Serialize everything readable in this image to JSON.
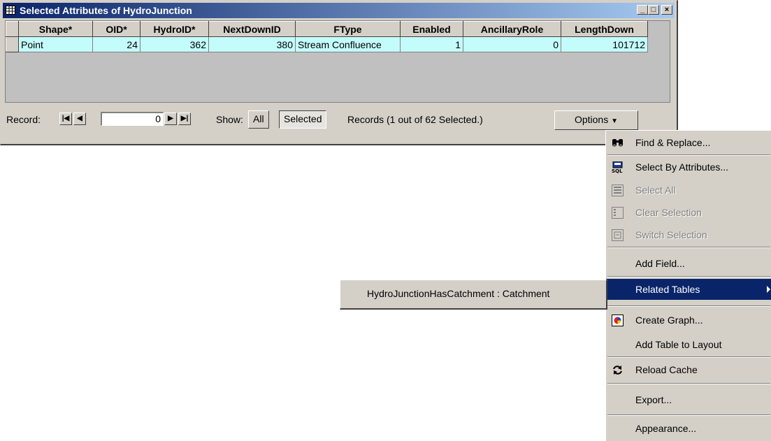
{
  "window": {
    "title": "Selected Attributes of HydroJunction",
    "minimize_glyph": "_",
    "maximize_glyph": "□",
    "close_glyph": "×"
  },
  "table": {
    "columns": [
      "Shape*",
      "OID*",
      "HydroID*",
      "NextDownID",
      "FType",
      "Enabled",
      "AncillaryRole",
      "LengthDown"
    ],
    "rows": [
      [
        "Point",
        "24",
        "362",
        "380",
        "Stream Confluence",
        "1",
        "0",
        "101712"
      ]
    ]
  },
  "statusbar": {
    "record_label": "Record:",
    "record_value": "0",
    "show_label": "Show:",
    "all_button": "All",
    "selected_button": "Selected",
    "records_text": "Records  (1 out of 62 Selected.)",
    "options_button": "Options"
  },
  "menu": {
    "items": [
      {
        "label": "Find & Replace...",
        "icon": "binoculars-icon",
        "enabled": true
      },
      {
        "label": "Select By Attributes...",
        "icon": "sql-icon",
        "enabled": true
      },
      {
        "label": "Select All",
        "icon": "select-all-icon",
        "enabled": false
      },
      {
        "label": "Clear Selection",
        "icon": "clear-selection-icon",
        "enabled": false
      },
      {
        "label": "Switch Selection",
        "icon": "switch-selection-icon",
        "enabled": false
      },
      {
        "label": "Add Field...",
        "icon": "",
        "enabled": true
      },
      {
        "label": "Related Tables",
        "icon": "",
        "enabled": true,
        "highlighted": true
      },
      {
        "label": "Create Graph...",
        "icon": "graph-icon",
        "enabled": true
      },
      {
        "label": "Add Table to Layout",
        "icon": "",
        "enabled": true
      },
      {
        "label": "Reload Cache",
        "icon": "reload-icon",
        "enabled": true
      },
      {
        "label": "Export...",
        "icon": "",
        "enabled": true
      },
      {
        "label": "Appearance...",
        "icon": "",
        "enabled": true
      }
    ],
    "highlight_color": "#0a246a"
  },
  "submenu": {
    "items": [
      {
        "label": "HydroJunctionHasCatchment : Catchment"
      }
    ]
  },
  "colors": {
    "row_background": "#c4fcfc",
    "title_gradient_start": "#0a246a",
    "title_gradient_end": "#a6caf0",
    "face": "#d4d0c8"
  }
}
